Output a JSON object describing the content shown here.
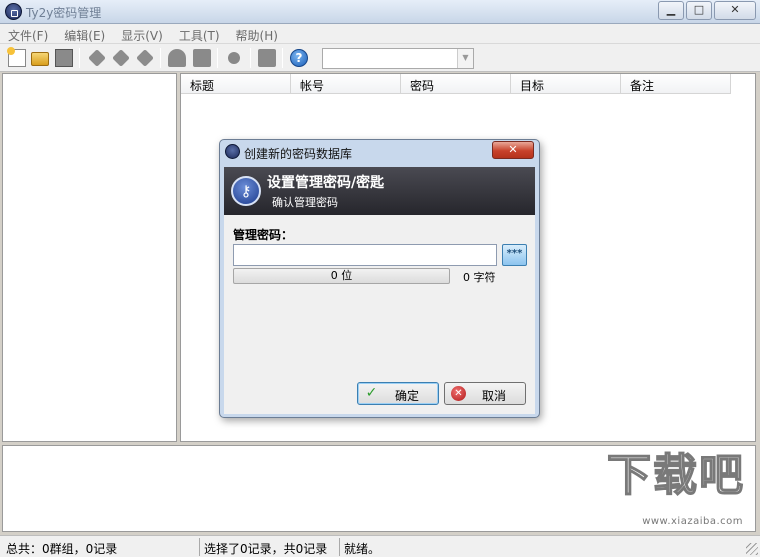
{
  "window": {
    "title": "Ty2y密码管理",
    "minimize_glyph": "▁",
    "maximize_glyph": "□",
    "close_glyph": "✕"
  },
  "menu": {
    "items": [
      {
        "label": "文件(F)"
      },
      {
        "label": "编辑(E)"
      },
      {
        "label": "显示(V)"
      },
      {
        "label": "工具(T)"
      },
      {
        "label": "帮助(H)"
      }
    ]
  },
  "toolbar": {
    "icons": [
      "new-file-icon",
      "open-folder-icon",
      "save-icon",
      "add-entry-icon",
      "edit-entry-icon",
      "delete-entry-icon",
      "user-icon",
      "note-icon",
      "search-icon",
      "settings-icon",
      "help-icon"
    ],
    "help_glyph": "?",
    "combo_value": "",
    "combo_arrow": "▼"
  },
  "table": {
    "columns": [
      "标题",
      "帐号",
      "密码",
      "目标",
      "备注"
    ]
  },
  "dialog": {
    "title": "创建新的密码数据库",
    "close_glyph": "✕",
    "banner_title": "设置管理密码/密匙",
    "banner_subtitle": "确认管理密码",
    "key_glyph": "⚷",
    "field_label": "管理密码：",
    "password_value": "",
    "toggle_label": "***",
    "strength": {
      "percent": 0,
      "text": "0 位"
    },
    "char_count": "0 字符",
    "ok_label": "确定",
    "ok_glyph": "✓",
    "cancel_label": "取消",
    "cancel_glyph": "✕"
  },
  "status": {
    "summary": "总共：0群组，0记录",
    "selection": "选择了0记录，共0记录",
    "state": "就绪。"
  },
  "watermark": {
    "text": "下载吧",
    "url": "www.xiazaiba.com"
  },
  "colors": {
    "accent": "#3c7fb1",
    "banner": "#2e2e34",
    "close_red": "#c8422b"
  }
}
